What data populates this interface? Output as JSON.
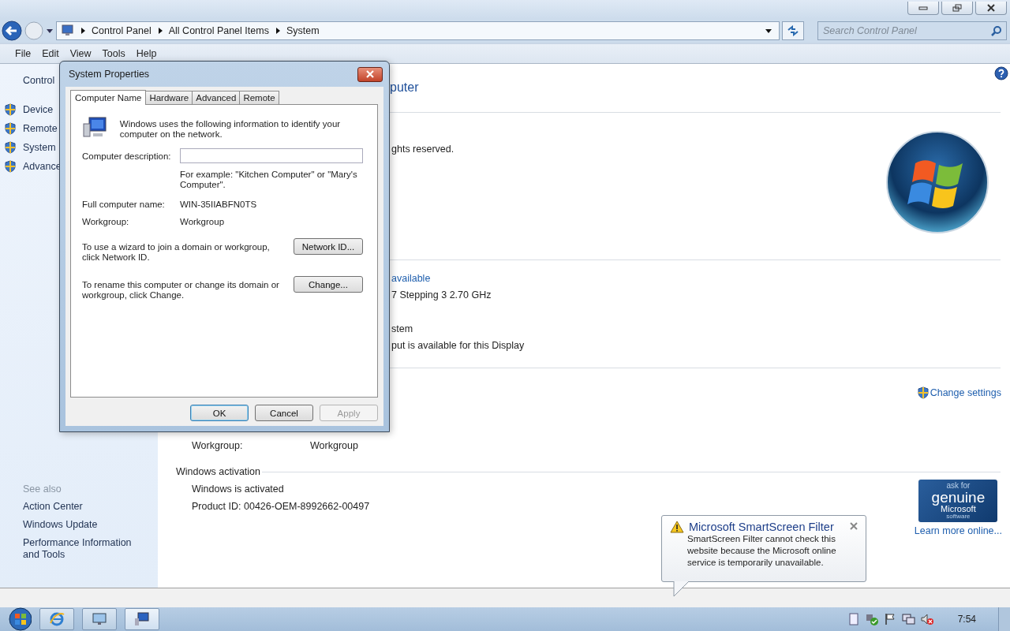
{
  "address_bar": {
    "breadcrumbs": [
      "Control Panel",
      "All Control Panel Items",
      "System"
    ]
  },
  "search": {
    "placeholder": "Search Control Panel"
  },
  "menu": [
    "File",
    "Edit",
    "View",
    "Tools",
    "Help"
  ],
  "sidebar": {
    "home": "Control",
    "tasks": [
      "Device",
      "Remote",
      "System",
      "Advance"
    ],
    "see_also_title": "See also",
    "see_also": [
      "Action Center",
      "Windows Update",
      "Performance Information and Tools"
    ]
  },
  "main": {
    "title": "puter",
    "copyright": "ghts reserved.",
    "rating_link": "available",
    "processor": "7 Stepping 3  2.70 GHz",
    "system_type": "stem",
    "pen_touch": "put is available for this Display",
    "change_settings": "Change settings",
    "workgroup_label": "Workgroup:",
    "workgroup_value": "Workgroup",
    "activation_heading": "Windows activation",
    "activation_status": "Windows is activated",
    "product_id": "Product ID: 00426-OEM-8992662-00497",
    "genuine_badge": [
      "ask for",
      "genuine",
      "Microsoft",
      "software"
    ],
    "learn_more": "Learn more online..."
  },
  "dialog": {
    "title": "System Properties",
    "tabs": [
      {
        "label": "Computer Name",
        "selected": true
      },
      {
        "label": "Hardware",
        "selected": false
      },
      {
        "label": "Advanced",
        "selected": false
      },
      {
        "label": "Remote",
        "selected": false
      }
    ],
    "intro": "Windows uses the following information to identify your computer on the network.",
    "description_label": "Computer description:",
    "example": "For example: \"Kitchen Computer\" or \"Mary's Computer\".",
    "full_name_label": "Full computer name:",
    "full_name_value": "WIN-35IIABFN0TS",
    "workgroup_label": "Workgroup:",
    "workgroup_value": "Workgroup",
    "network_text": "To use a wizard to join a domain or workgroup, click Network ID.",
    "network_button": "Network ID...",
    "change_text": "To rename this computer or change its domain or workgroup, click Change.",
    "change_button": "Change...",
    "buttons": [
      {
        "label": "OK",
        "kind": "default"
      },
      {
        "label": "Cancel",
        "kind": "normal"
      },
      {
        "label": "Apply",
        "kind": "disabled"
      }
    ]
  },
  "balloon": {
    "title": "Microsoft SmartScreen Filter",
    "text": "SmartScreen Filter cannot check this website because the Microsoft online service is temporarily unavailable."
  },
  "taskbar": {
    "clock": "7:54"
  }
}
